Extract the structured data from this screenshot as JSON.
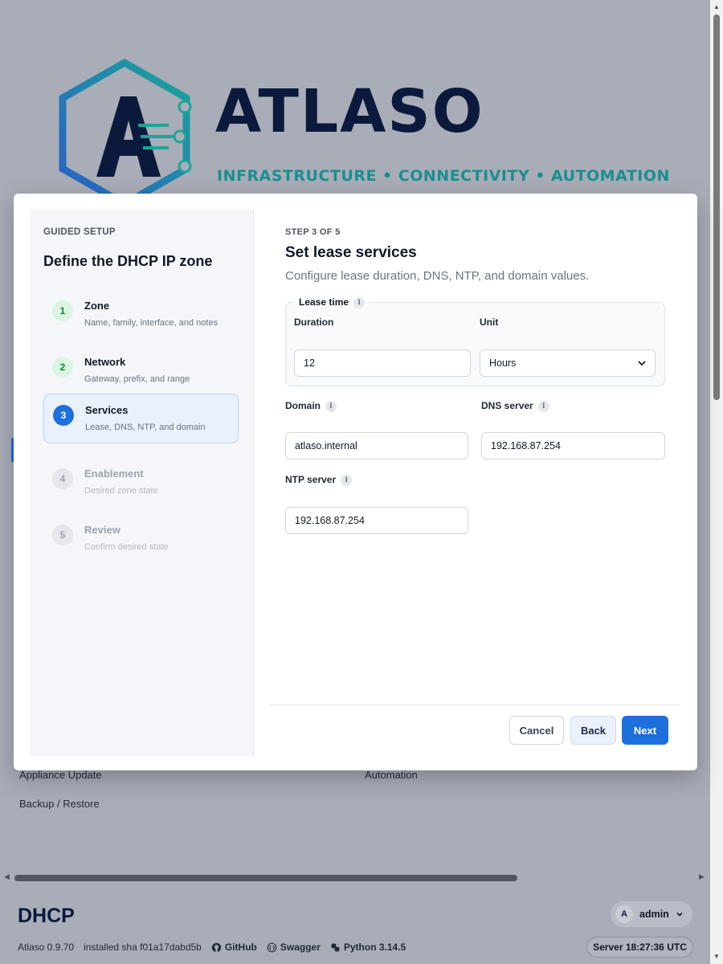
{
  "brand": {
    "name": "ATLASO",
    "tagline": "INFRASTRUCTURE • CONNECTIVITY • AUTOMATION",
    "colors": {
      "navy": "#0b1a3c",
      "teal": "#1a8f8f",
      "blue": "#1d6fdc"
    }
  },
  "background_links": {
    "appliance_update": "Appliance Update",
    "automation": "Automation",
    "backup_restore": "Backup / Restore"
  },
  "footer": {
    "title": "DHCP",
    "user": {
      "avatar_initial": "A",
      "name": "admin"
    },
    "version": "Atlaso 0.9.70",
    "installed_sha": "installed sha f01a17dabd5b",
    "links": {
      "github": "GitHub",
      "swagger": "Swagger",
      "python": "Python 3.14.5"
    },
    "server_time": "Server 18:27:36 UTC"
  },
  "wizard": {
    "guided_label": "GUIDED SETUP",
    "title": "Define the DHCP IP zone",
    "steps": [
      {
        "number": "1",
        "label": "Zone",
        "description": "Name, family, interface, and notes",
        "state": "done"
      },
      {
        "number": "2",
        "label": "Network",
        "description": "Gateway, prefix, and range",
        "state": "done"
      },
      {
        "number": "3",
        "label": "Services",
        "description": "Lease, DNS, NTP, and domain",
        "state": "current"
      },
      {
        "number": "4",
        "label": "Enablement",
        "description": "Desired zone state",
        "state": "todo"
      },
      {
        "number": "5",
        "label": "Review",
        "description": "Confirm desired state",
        "state": "todo"
      }
    ],
    "step_indicator": "STEP 3 OF 5",
    "step_title": "Set lease services",
    "step_subtitle": "Configure lease duration, DNS, NTP, and domain values.",
    "lease": {
      "legend": "Lease time",
      "duration_label": "Duration",
      "duration_value": "12",
      "unit_label": "Unit",
      "unit_value": "Hours"
    },
    "domain": {
      "label": "Domain",
      "value": "atlaso.internal"
    },
    "dns_server": {
      "label": "DNS server",
      "value": "192.168.87.254"
    },
    "ntp_server": {
      "label": "NTP server",
      "value": "192.168.87.254"
    },
    "buttons": {
      "cancel": "Cancel",
      "back": "Back",
      "next": "Next"
    }
  }
}
